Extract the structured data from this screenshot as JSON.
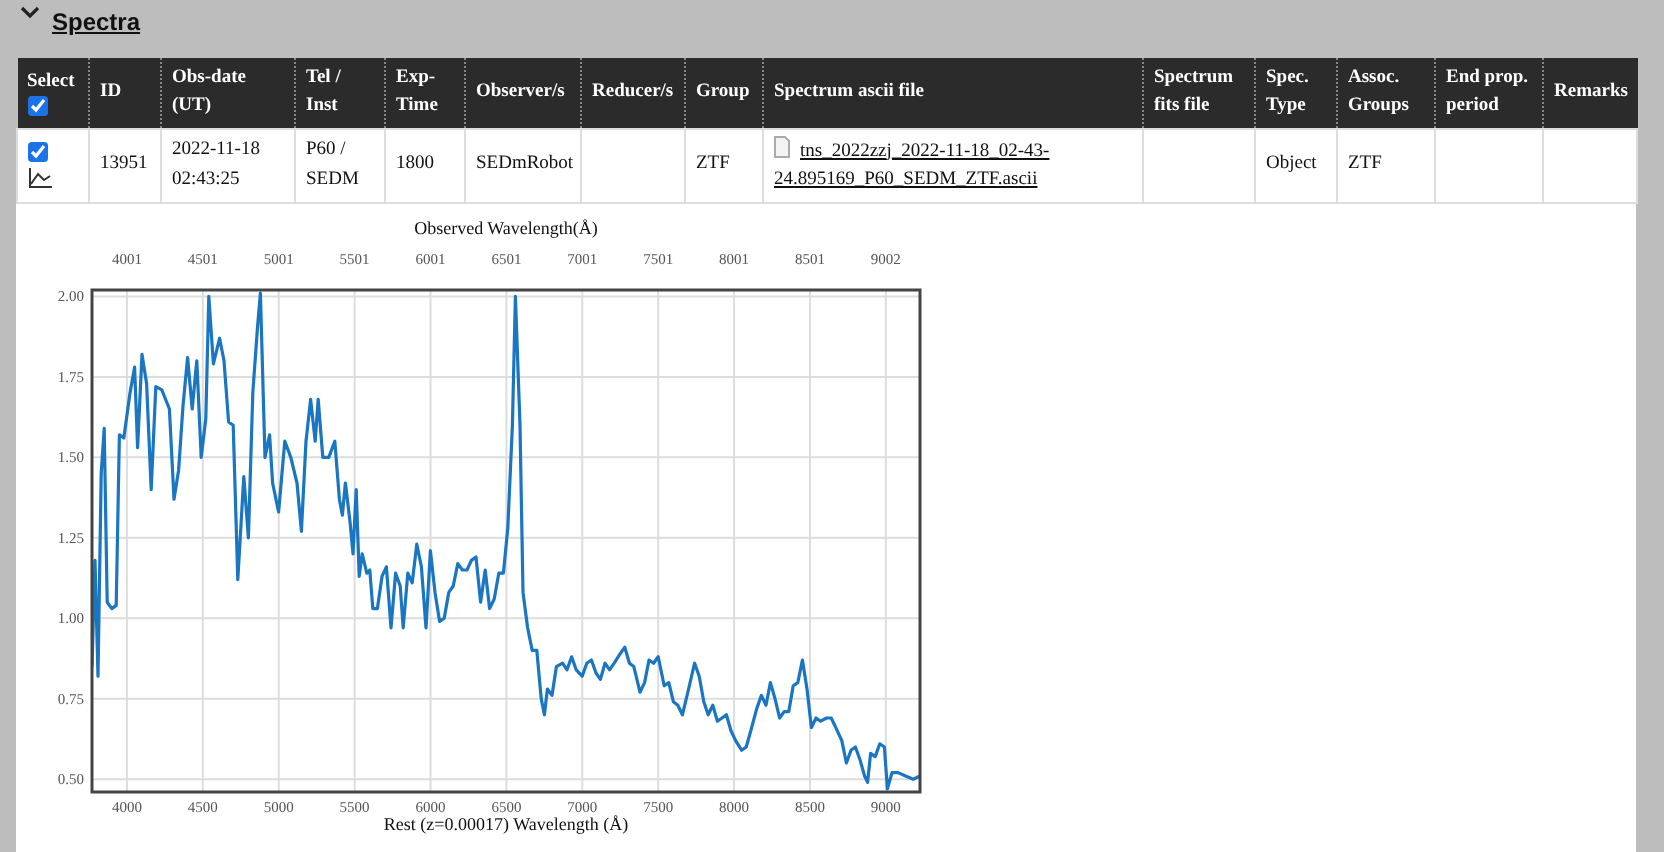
{
  "section": {
    "title": "Spectra",
    "expanded": true
  },
  "table": {
    "select_all": {
      "checked": true
    },
    "columns": [
      "Select",
      "ID",
      "Obs-date (UT)",
      "Tel / Inst",
      "Exp-Time",
      "Observer/s",
      "Reducer/s",
      "Group",
      "Spectrum ascii file",
      "Spectrum fits file",
      "Spec. Type",
      "Assoc. Groups",
      "End prop. period",
      "Remarks"
    ],
    "rows": [
      {
        "cells": [
          {
            "kind": "select",
            "checked": true
          },
          "13951",
          "2022-11-18 02:43:25",
          "P60 / SEDM",
          "1800",
          "SEDmRobot",
          "",
          "ZTF",
          {
            "kind": "file",
            "text": "tns_2022zzj_2022-11-18_02-43-24.895169_P60_SEDM_ZTF.ascii"
          },
          "",
          "Object",
          "ZTF",
          "",
          ""
        ]
      }
    ]
  },
  "top_axis": {
    "title": "Observed Wavelength(Å)",
    "labels": [
      "4001",
      "4501",
      "5001",
      "5501",
      "6001",
      "6501",
      "7001",
      "7501",
      "8001",
      "8501",
      "9002"
    ]
  },
  "chart_data": {
    "type": "line",
    "grid": true,
    "xlabel": "Rest (z=0.00017) Wavelength (Å)",
    "x": [
      3770,
      3790,
      3810,
      3830,
      3850,
      3870,
      3900,
      3930,
      3950,
      3980,
      4020,
      4050,
      4070,
      4100,
      4130,
      4160,
      4190,
      4230,
      4280,
      4310,
      4340,
      4370,
      4400,
      4430,
      4460,
      4490,
      4520,
      4540,
      4570,
      4610,
      4640,
      4670,
      4700,
      4730,
      4770,
      4800,
      4830,
      4860,
      4880,
      4910,
      4940,
      4960,
      5000,
      5040,
      5080,
      5120,
      5150,
      5180,
      5210,
      5240,
      5260,
      5290,
      5330,
      5370,
      5400,
      5420,
      5440,
      5470,
      5490,
      5510,
      5530,
      5550,
      5580,
      5600,
      5620,
      5650,
      5680,
      5710,
      5740,
      5770,
      5800,
      5820,
      5850,
      5880,
      5910,
      5940,
      5970,
      6000,
      6030,
      6060,
      6090,
      6120,
      6150,
      6180,
      6210,
      6240,
      6270,
      6300,
      6330,
      6360,
      6390,
      6420,
      6450,
      6480,
      6510,
      6540,
      6560,
      6590,
      6610,
      6640,
      6670,
      6700,
      6730,
      6750,
      6770,
      6800,
      6830,
      6870,
      6900,
      6930,
      6960,
      7000,
      7030,
      7060,
      7090,
      7120,
      7150,
      7180,
      7210,
      7250,
      7280,
      7310,
      7340,
      7380,
      7410,
      7440,
      7470,
      7500,
      7540,
      7570,
      7600,
      7630,
      7660,
      7700,
      7740,
      7770,
      7800,
      7830,
      7860,
      7890,
      7920,
      7950,
      7980,
      8010,
      8050,
      8080,
      8110,
      8150,
      8180,
      8210,
      8240,
      8270,
      8300,
      8330,
      8360,
      8390,
      8420,
      8450,
      8480,
      8510,
      8540,
      8570,
      8610,
      8640,
      8670,
      8710,
      8740,
      8770,
      8800,
      8830,
      8860,
      8880,
      8900,
      8930,
      8960,
      8990,
      9010,
      9040,
      9080,
      9130,
      9180,
      9225
    ],
    "series": [
      {
        "color": "#1a75c2",
        "values": [
          0.85,
          1.18,
          0.82,
          1.45,
          1.59,
          1.05,
          1.03,
          1.04,
          1.57,
          1.56,
          1.7,
          1.78,
          1.53,
          1.82,
          1.73,
          1.4,
          1.72,
          1.71,
          1.65,
          1.37,
          1.46,
          1.66,
          1.81,
          1.65,
          1.8,
          1.5,
          1.62,
          2.0,
          1.79,
          1.87,
          1.8,
          1.61,
          1.6,
          1.12,
          1.44,
          1.25,
          1.7,
          1.9,
          2.01,
          1.5,
          1.57,
          1.42,
          1.33,
          1.55,
          1.5,
          1.42,
          1.27,
          1.55,
          1.68,
          1.55,
          1.68,
          1.5,
          1.5,
          1.55,
          1.37,
          1.32,
          1.42,
          1.3,
          1.2,
          1.4,
          1.13,
          1.2,
          1.14,
          1.15,
          1.03,
          1.03,
          1.13,
          1.16,
          0.97,
          1.14,
          1.1,
          0.97,
          1.14,
          1.11,
          1.23,
          1.16,
          0.97,
          1.21,
          1.08,
          0.99,
          1.0,
          1.08,
          1.1,
          1.17,
          1.15,
          1.15,
          1.18,
          1.19,
          1.05,
          1.15,
          1.03,
          1.06,
          1.14,
          1.14,
          1.28,
          1.6,
          2.0,
          1.6,
          1.08,
          0.97,
          0.9,
          0.9,
          0.75,
          0.7,
          0.78,
          0.76,
          0.85,
          0.86,
          0.84,
          0.88,
          0.84,
          0.82,
          0.86,
          0.87,
          0.83,
          0.81,
          0.86,
          0.84,
          0.86,
          0.89,
          0.91,
          0.86,
          0.85,
          0.77,
          0.8,
          0.87,
          0.86,
          0.88,
          0.79,
          0.8,
          0.74,
          0.73,
          0.7,
          0.78,
          0.86,
          0.82,
          0.74,
          0.7,
          0.73,
          0.68,
          0.69,
          0.7,
          0.65,
          0.62,
          0.59,
          0.6,
          0.65,
          0.72,
          0.76,
          0.73,
          0.8,
          0.75,
          0.69,
          0.71,
          0.71,
          0.79,
          0.8,
          0.87,
          0.78,
          0.66,
          0.69,
          0.68,
          0.69,
          0.69,
          0.66,
          0.62,
          0.55,
          0.59,
          0.6,
          0.56,
          0.51,
          0.49,
          0.58,
          0.57,
          0.61,
          0.6,
          0.47,
          0.52,
          0.52,
          0.51,
          0.5,
          0.51
        ]
      }
    ],
    "xlim": [
      3770,
      9225
    ],
    "ylim": [
      0.46,
      2.02
    ],
    "xticks": [
      4000,
      4500,
      5000,
      5500,
      6000,
      6500,
      7000,
      7500,
      8000,
      8500,
      9000
    ],
    "yticks": [
      {
        "value": 0.5,
        "label": "0.50"
      },
      {
        "value": 0.75,
        "label": "0.75"
      },
      {
        "value": 1.0,
        "label": "1.00"
      },
      {
        "value": 1.25,
        "label": "1.25"
      },
      {
        "value": 1.5,
        "label": "1.50"
      },
      {
        "value": 1.75,
        "label": "1.75"
      },
      {
        "value": 2.0,
        "label": "2.00"
      }
    ]
  }
}
